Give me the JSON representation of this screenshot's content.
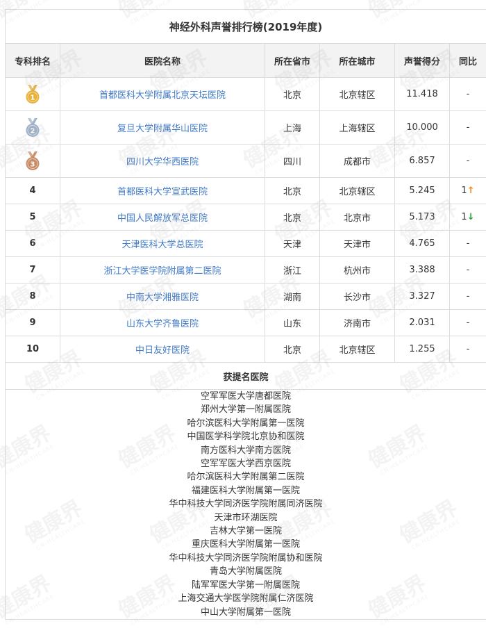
{
  "title": "神经外科声誉排行榜(2019年度)",
  "headers": [
    "专科排名",
    "医院名称",
    "所在省市",
    "所在城市",
    "声誉得分",
    "同比"
  ],
  "rows": [
    {
      "rank": "1",
      "medal": "gold",
      "hospital": "首都医科大学附属北京天坛医院",
      "province": "北京",
      "city": "北京辖区",
      "score": "11.418",
      "change": "-",
      "trend": ""
    },
    {
      "rank": "2",
      "medal": "silver",
      "hospital": "复旦大学附属华山医院",
      "province": "上海",
      "city": "上海辖区",
      "score": "10.000",
      "change": "-",
      "trend": ""
    },
    {
      "rank": "3",
      "medal": "bronze",
      "hospital": "四川大学华西医院",
      "province": "四川",
      "city": "成都市",
      "score": "6.857",
      "change": "-",
      "trend": ""
    },
    {
      "rank": "4",
      "medal": "",
      "hospital": "首都医科大学宣武医院",
      "province": "北京",
      "city": "北京辖区",
      "score": "5.245",
      "change": "1",
      "trend": "up"
    },
    {
      "rank": "5",
      "medal": "",
      "hospital": "中国人民解放军总医院",
      "province": "北京",
      "city": "北京市",
      "score": "5.173",
      "change": "1",
      "trend": "down"
    },
    {
      "rank": "6",
      "medal": "",
      "hospital": "天津医科大学总医院",
      "province": "天津",
      "city": "天津市",
      "score": "4.765",
      "change": "-",
      "trend": ""
    },
    {
      "rank": "7",
      "medal": "",
      "hospital": "浙江大学医学院附属第二医院",
      "province": "浙江",
      "city": "杭州市",
      "score": "3.388",
      "change": "-",
      "trend": ""
    },
    {
      "rank": "8",
      "medal": "",
      "hospital": "中南大学湘雅医院",
      "province": "湖南",
      "city": "长沙市",
      "score": "3.327",
      "change": "-",
      "trend": ""
    },
    {
      "rank": "9",
      "medal": "",
      "hospital": "山东大学齐鲁医院",
      "province": "山东",
      "city": "济南市",
      "score": "2.031",
      "change": "-",
      "trend": ""
    },
    {
      "rank": "10",
      "medal": "",
      "hospital": "中日友好医院",
      "province": "北京",
      "city": "北京辖区",
      "score": "1.255",
      "change": "-",
      "trend": ""
    }
  ],
  "nominated_title": "获提名医院",
  "nominated": [
    "空军军医大学唐都医院",
    "郑州大学第一附属医院",
    "哈尔滨医科大学附属第一医院",
    "中国医学科学院北京协和医院",
    "南方医科大学南方医院",
    "空军军医大学西京医院",
    "哈尔滨医科大学附属第二医院",
    "福建医科大学附属第一医院",
    "华中科技大学同济医学院附属同济医院",
    "天津市环湖医院",
    "吉林大学第一医院",
    "重庆医科大学附属第一医院",
    "华中科技大学同济医学院附属协和医院",
    "青岛大学附属医院",
    "陆军军医大学第一附属医院",
    "上海交通大学医学院附属仁济医院",
    "中山大学附属第一医院"
  ],
  "watermark": {
    "main": "健康界",
    "sub": "CN-HEALTHCARE"
  },
  "colors": {
    "link": "#3e79c8",
    "up": "#f08a1c",
    "down": "#27a43b",
    "gold": "#e8b23a",
    "silver": "#9fb1c9",
    "bronze": "#c98a66",
    "header_bg": "#f3f3f3"
  },
  "icons": {
    "up": "arrow-up-icon",
    "down": "arrow-down-icon",
    "medal": "medal-icon"
  }
}
